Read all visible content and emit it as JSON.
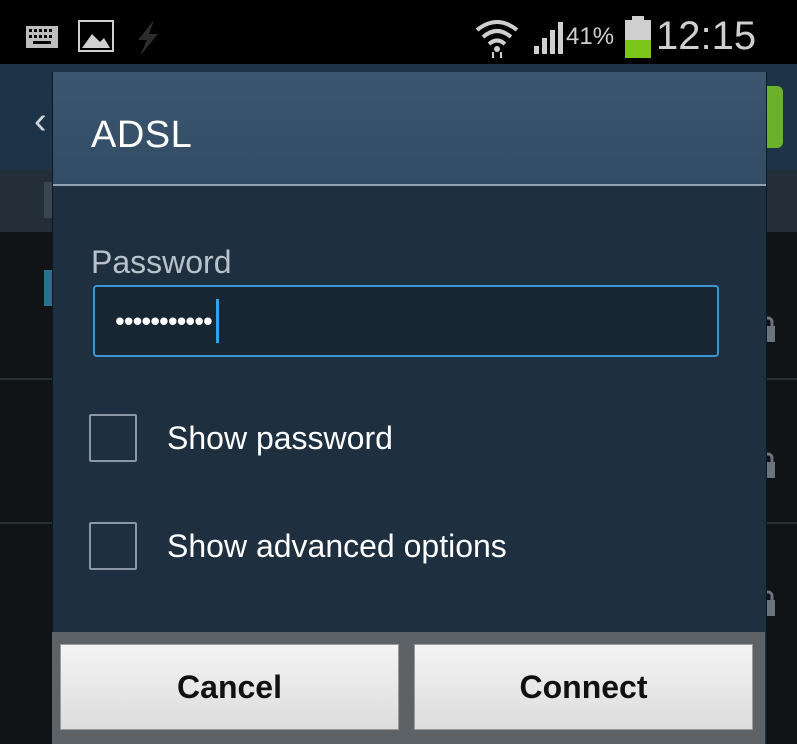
{
  "status_bar": {
    "icons": [
      "keyboard-icon",
      "image-icon",
      "usb-icon",
      "wifi-icon",
      "signal-icon",
      "battery-icon"
    ],
    "battery_percent": "41%",
    "time": "12:15"
  },
  "dialog": {
    "title": "ADSL",
    "password_label": "Password",
    "password_value": "•••••••••••",
    "show_password_label": "Show password",
    "show_advanced_label": "Show advanced options",
    "show_password_checked": false,
    "show_advanced_checked": false
  },
  "buttons": {
    "cancel": "Cancel",
    "connect": "Connect"
  },
  "colors": {
    "dialog_body": "#1e3040",
    "dialog_header": "#3d5670",
    "field_focus_border": "#3d96d0",
    "battery_fill": "#7cc51a"
  }
}
